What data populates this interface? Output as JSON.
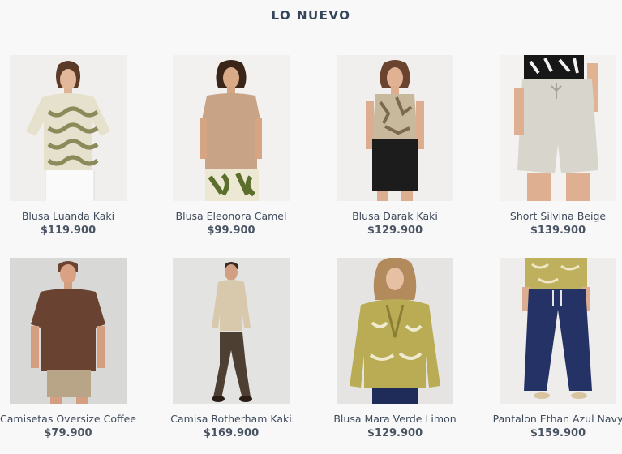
{
  "section": {
    "title": "LO NUEVO"
  },
  "products": [
    {
      "name": "Blusa Luanda Kaki",
      "price": "$119.900",
      "image": "model-print-blouse-white-shorts"
    },
    {
      "name": "Blusa Eleonora Camel",
      "price": "$99.900",
      "image": "model-camel-blouse-print-pants"
    },
    {
      "name": "Blusa Darak Kaki",
      "price": "$129.900",
      "image": "model-print-tank-black-shorts"
    },
    {
      "name": "Short Silvina Beige",
      "price": "$139.900",
      "image": "model-beige-linen-shorts"
    },
    {
      "name": "Camisetas Oversize Coffee",
      "price": "$79.900",
      "image": "model-coffee-tshirt-khaki-shorts"
    },
    {
      "name": "Camisa Rotherham Kaki",
      "price": "$169.900",
      "image": "model-khaki-shirt-brown-pants"
    },
    {
      "name": "Blusa Mara Verde Limon",
      "price": "$129.900",
      "image": "model-lime-print-blouse"
    },
    {
      "name": "Pantalon Ethan Azul Navy",
      "price": "$159.900",
      "image": "model-navy-wide-pants"
    }
  ]
}
